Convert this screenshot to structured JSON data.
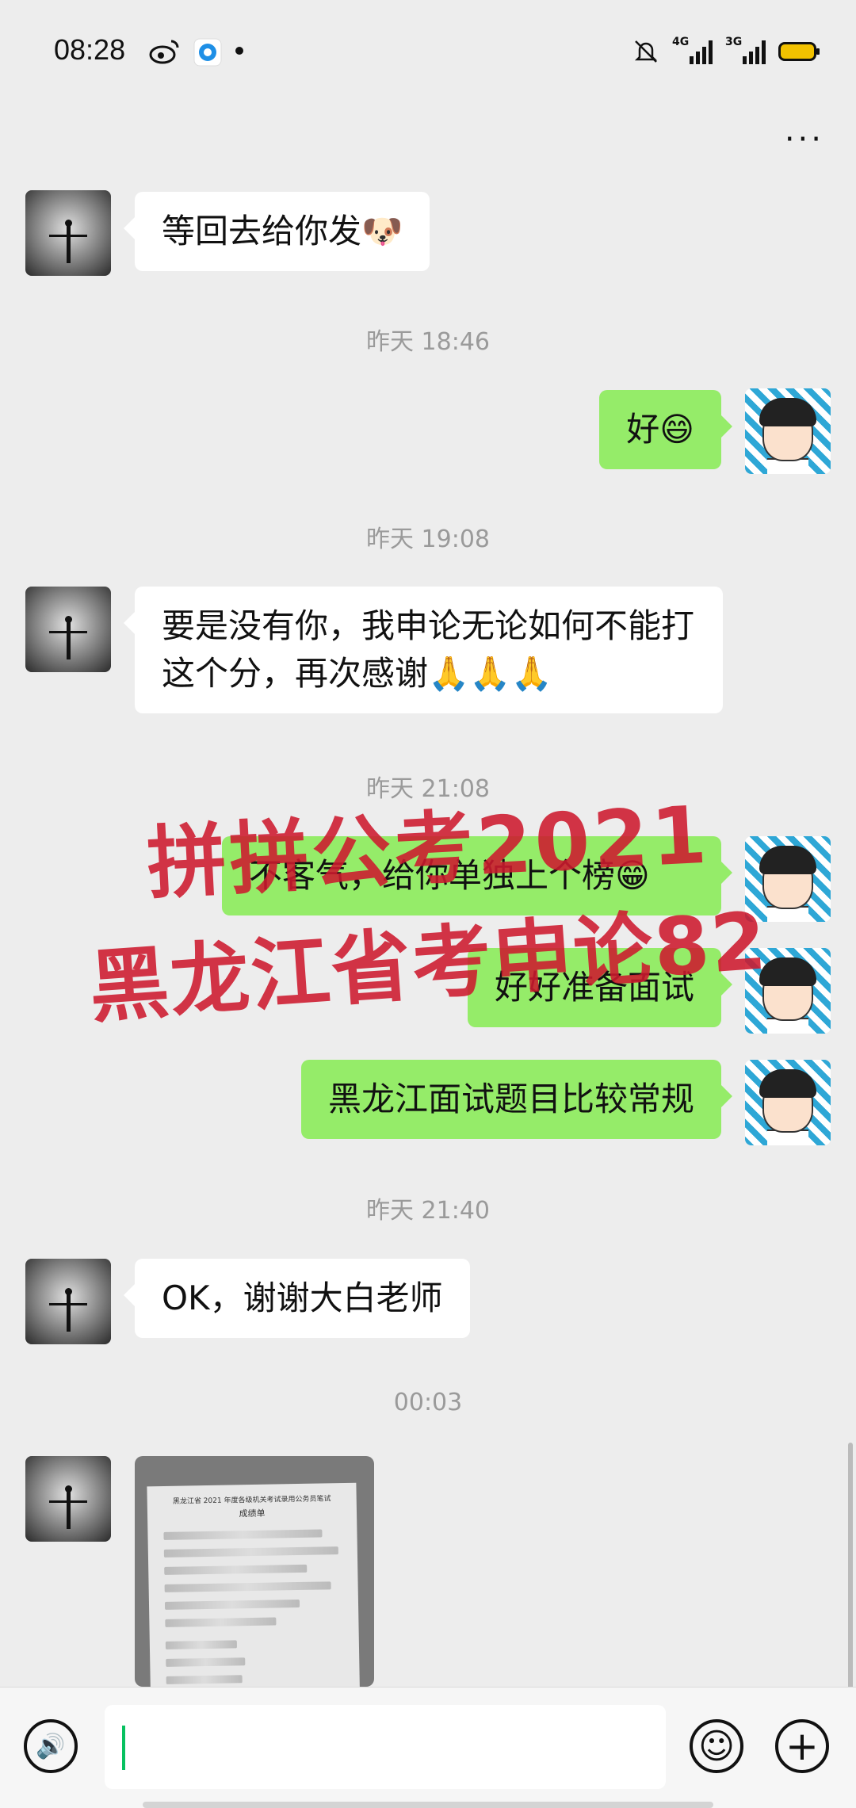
{
  "status_bar": {
    "time": "08:28",
    "icons": [
      "weibo-icon",
      "app-notification-icon",
      "dot-icon",
      "mute-bell-icon",
      "signal-4g-icon",
      "signal-3g-icon",
      "battery-icon"
    ],
    "network_1": "4G",
    "network_2": "3G",
    "battery_color": "#f2c200"
  },
  "header": {
    "more": "···"
  },
  "messages": [
    {
      "side": "them",
      "text": "等回去给你发🐶"
    },
    {
      "type": "timestamp",
      "text": "昨天 18:46"
    },
    {
      "side": "me",
      "text": "好😄"
    },
    {
      "type": "timestamp",
      "text": "昨天 19:08"
    },
    {
      "side": "them",
      "text": "要是没有你，我申论无论如何不能打这个分，再次感谢🙏🙏🙏"
    },
    {
      "type": "timestamp",
      "text": "昨天 21:08"
    },
    {
      "side": "me",
      "text": "不客气，给你单独上个榜😁"
    },
    {
      "side": "me",
      "text": "好好准备面试"
    },
    {
      "side": "me",
      "text": "黑龙江面试题目比较常规"
    },
    {
      "type": "timestamp",
      "text": "昨天 21:40"
    },
    {
      "side": "them",
      "text": "OK，谢谢大白老师"
    },
    {
      "type": "timestamp",
      "text": "00:03"
    },
    {
      "side": "them",
      "type": "image",
      "title": "黑龙江省 2021 年度各级机关考试录用公务员笔试",
      "subtitle": "成绩单"
    }
  ],
  "watermark": {
    "line1": "拼拼公考2021",
    "line2": "黑龙江省考申论82"
  },
  "colors": {
    "background": "#ededed",
    "bubble_me": "#95ec69",
    "bubble_them": "#ffffff",
    "watermark": "#cd192d",
    "caret": "#07c160"
  },
  "input_bar": {
    "voice": "🔊",
    "emoji": "☺",
    "plus": "+"
  }
}
